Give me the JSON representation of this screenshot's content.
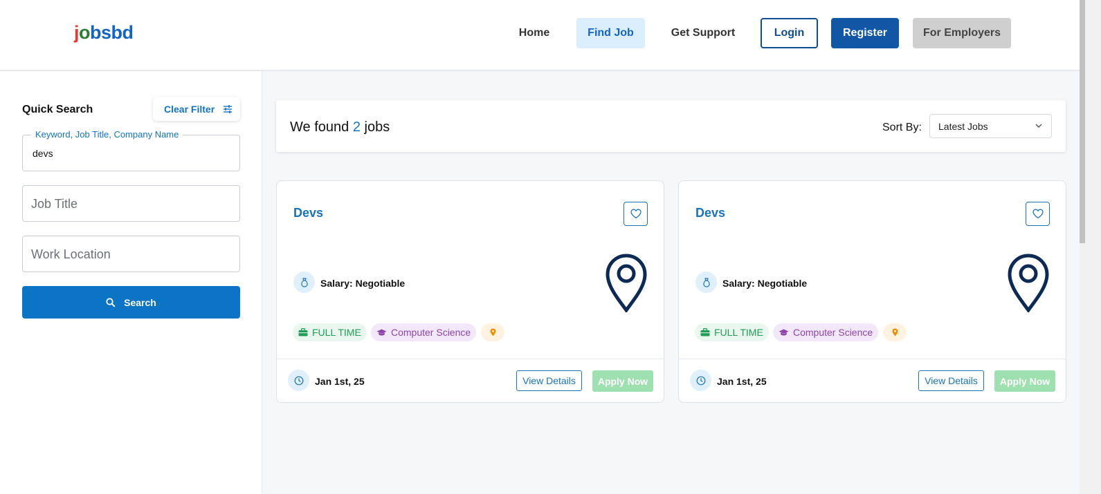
{
  "header": {
    "logo": {
      "part1": "j",
      "part2": "o",
      "part3": "bsbd"
    },
    "nav": {
      "home": "Home",
      "find_job": "Find Job",
      "get_support": "Get Support",
      "login": "Login",
      "register": "Register",
      "for_employers": "For Employers"
    }
  },
  "sidebar": {
    "title": "Quick Search",
    "clear_filter": "Clear Filter",
    "keyword_label": "Keyword, Job Title, Company Name",
    "keyword_value": "devs",
    "job_title_placeholder": "Job Title",
    "work_location_placeholder": "Work Location",
    "search_label": "Search"
  },
  "results": {
    "found_prefix": "We found",
    "count": "2",
    "found_suffix": "jobs",
    "sort_label": "Sort By:",
    "sort_value": "Latest Jobs"
  },
  "jobs": [
    {
      "title": "Devs",
      "salary": "Salary: Negotiable",
      "job_type": "FULL TIME",
      "department": "Computer Science",
      "date": "Jan 1st, 25",
      "view_details": "View Details",
      "apply_now": "Apply Now"
    },
    {
      "title": "Devs",
      "salary": "Salary: Negotiable",
      "job_type": "FULL TIME",
      "department": "Computer Science",
      "date": "Jan 1st, 25",
      "view_details": "View Details",
      "apply_now": "Apply Now"
    }
  ],
  "colors": {
    "primary": "#0b74c4",
    "brand_navy": "#1256a6",
    "apply_disabled": "#9fe0b0",
    "fulltime_green": "#1f9d55",
    "department_purple": "#8e44ad",
    "location_orange": "#f08c00"
  }
}
